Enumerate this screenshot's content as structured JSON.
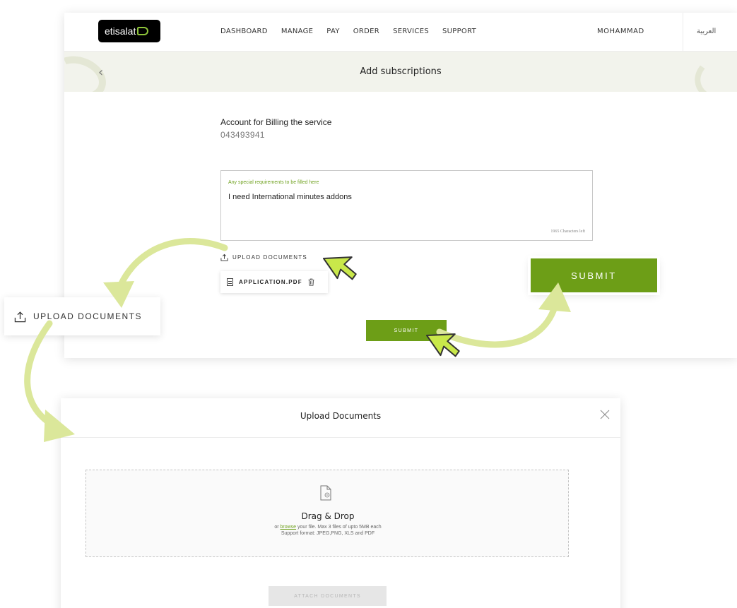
{
  "nav": {
    "logo_text": "etisalat",
    "menu": [
      "DASHBOARD",
      "MANAGE",
      "PAY",
      "ORDER",
      "SERVICES",
      "SUPPORT"
    ],
    "user_name": "MOHAMMAD",
    "language": "العربية"
  },
  "page": {
    "title": "Add subscriptions"
  },
  "account": {
    "label": "Account for Billing the service",
    "value": "043493941"
  },
  "requirements": {
    "label": "Any special requirements to be filled here",
    "value": "I need International minutes addons",
    "counter": "1965 Characters left"
  },
  "upload": {
    "link_label": "UPLOAD DOCUMENTS",
    "file_name": "APPLICATION.PDF"
  },
  "submit_label": "SUBMIT",
  "callouts": {
    "upload_label": "UPLOAD DOCUMENTS",
    "submit_label": "SUBMIT"
  },
  "modal": {
    "title": "Upload Documents",
    "drop_title": "Drag & Drop",
    "line1_prefix": "or ",
    "browse": "browse",
    "line1_suffix": " your file. Max 3 files of upto 5MB each",
    "line2": "Support format: JPEG,PNG, XLS and PDF",
    "attach_label": "ATTACH DOCUMENTS"
  },
  "colors": {
    "brand_green": "#6d9e17",
    "accent_green": "#6fa11f",
    "arrow_green": "#dbe79a",
    "cursor_green": "#c9e84a"
  },
  "icons": [
    "back-chevron-icon",
    "upload-icon",
    "file-icon",
    "trash-icon",
    "close-icon",
    "document-icon",
    "cursor-icon"
  ]
}
